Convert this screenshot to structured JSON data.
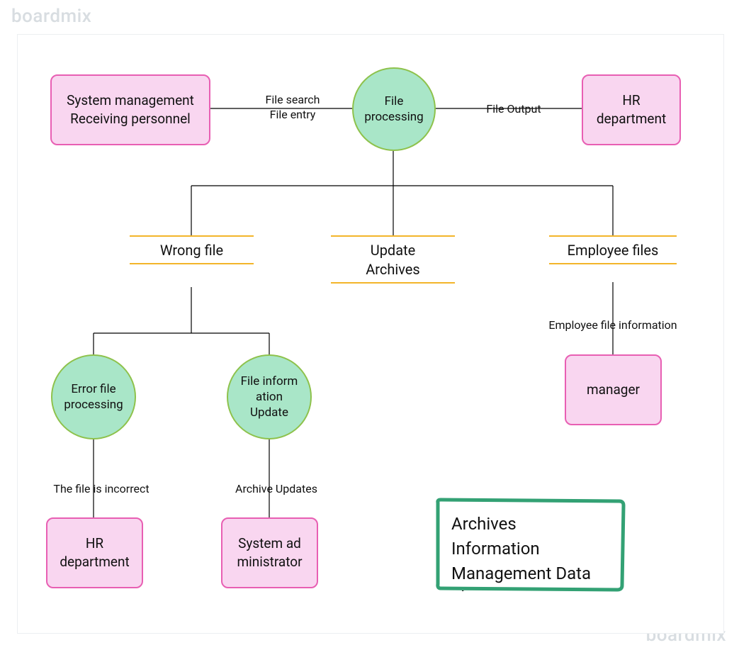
{
  "watermark": {
    "top": "boardmix",
    "bottom": "boardmix"
  },
  "nodes": {
    "sys_mgmt": {
      "label": "System management\nReceiving personnel"
    },
    "file_proc": {
      "label": "File\nprocessing"
    },
    "hr_top": {
      "label": "HR\ndepartment"
    },
    "wrong_file": {
      "label": "Wrong file"
    },
    "update_arch": {
      "label": "Update\nArchives"
    },
    "employee_files": {
      "label": "Employee files"
    },
    "err_proc": {
      "label": "Error file\nprocessing"
    },
    "file_update": {
      "label": "File inform\nation\nUpdate"
    },
    "manager": {
      "label": "manager"
    },
    "hr_bottom": {
      "label": "HR\ndepartment"
    },
    "sys_admin": {
      "label": "System ad\nministrator"
    }
  },
  "edges": {
    "file_search_entry": "File search\nFile entry",
    "file_output": "File Output",
    "emp_file_info": "Employee file information",
    "file_incorrect": "The file is incorrect",
    "archive_updates": "Archive Updates"
  },
  "title": "Archives Information Management Data Flow Diagram"
}
